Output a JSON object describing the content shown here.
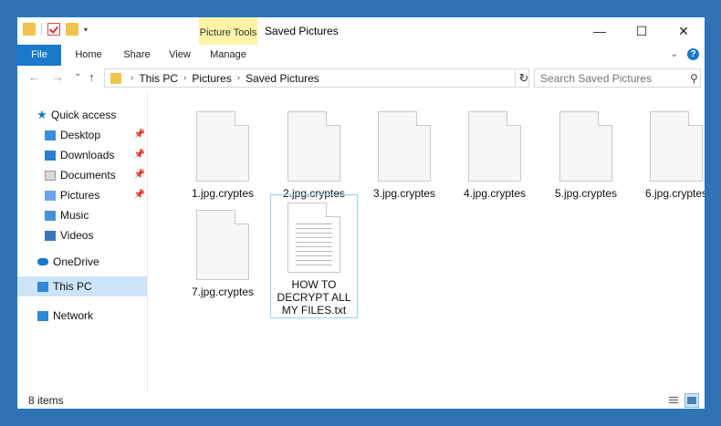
{
  "window": {
    "title": "Saved Pictures",
    "contextual_tab_group": "Picture Tools",
    "controls": {
      "minimize": "—",
      "maximize": "☐",
      "close": "✕"
    }
  },
  "ribbon": {
    "tabs": [
      {
        "label": "File"
      },
      {
        "label": "Home"
      },
      {
        "label": "Share"
      },
      {
        "label": "View"
      },
      {
        "label": "Manage"
      }
    ],
    "help": "?"
  },
  "address": {
    "back": "←",
    "forward": "→",
    "recent": "⌄",
    "up": "↑",
    "crumbs": [
      "This PC",
      "Pictures",
      "Saved Pictures"
    ],
    "refresh": "↻"
  },
  "search": {
    "placeholder": "Search Saved Pictures"
  },
  "sidebar": {
    "quick_access": "Quick access",
    "pinned": [
      {
        "label": "Desktop"
      },
      {
        "label": "Downloads"
      },
      {
        "label": "Documents"
      },
      {
        "label": "Pictures"
      }
    ],
    "others": [
      {
        "label": "Music"
      },
      {
        "label": "Videos"
      }
    ],
    "onedrive": "OneDrive",
    "this_pc": "This PC",
    "network": "Network"
  },
  "files": [
    {
      "name": "1.jpg.cryptes",
      "type": "cryptes"
    },
    {
      "name": "2.jpg.cryptes",
      "type": "cryptes"
    },
    {
      "name": "3.jpg.cryptes",
      "type": "cryptes"
    },
    {
      "name": "4.jpg.cryptes",
      "type": "cryptes"
    },
    {
      "name": "5.jpg.cryptes",
      "type": "cryptes"
    },
    {
      "name": "6.jpg.cryptes",
      "type": "cryptes"
    },
    {
      "name": "7.jpg.cryptes",
      "type": "cryptes"
    },
    {
      "name": "HOW TO DECRYPT ALL MY FILES.txt",
      "type": "txt"
    }
  ],
  "status": {
    "item_count": "8 items"
  },
  "colors": {
    "accent": "#1979ca",
    "contextual": "#fff3a6",
    "selection": "#cce4f7"
  }
}
